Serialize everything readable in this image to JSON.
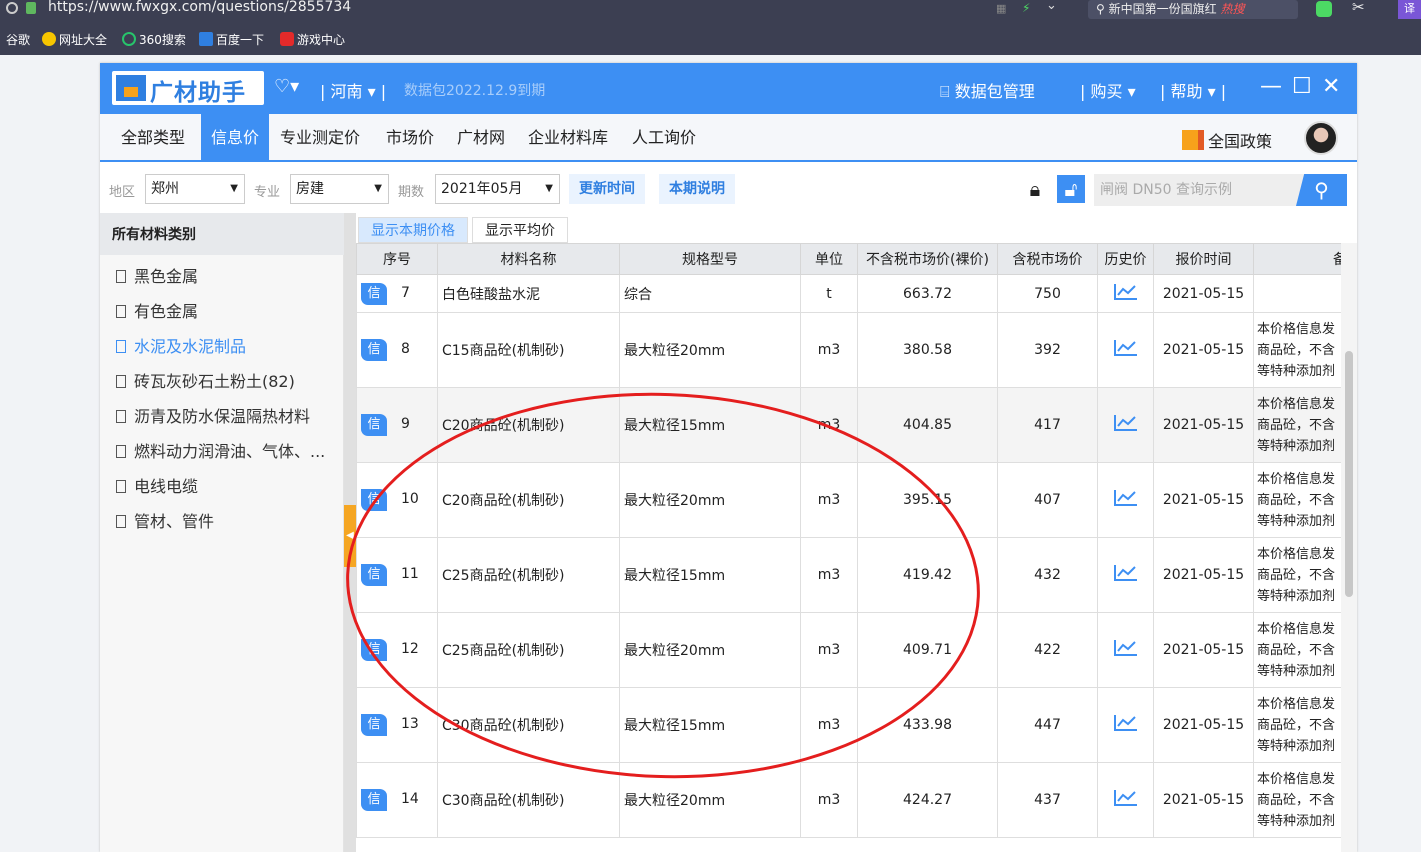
{
  "browser": {
    "url": "https://www.fwxgx.com/questions/2855734",
    "search_text": "新中国第一份国旗红",
    "search_hot": "热搜",
    "translate": "译"
  },
  "bookmarks": [
    "谷歌",
    "网址大全",
    "360搜索",
    "百度一下",
    "游戏中心"
  ],
  "app": {
    "logo": "广材助手",
    "region": "河南",
    "package_info": "数据包2022.12.9到期",
    "package_mgmt": "数据包管理",
    "buy": "购买",
    "help": "帮助",
    "nav_tabs": [
      "全部类型",
      "信息价",
      "专业测定价",
      "市场价",
      "广材网",
      "企业材料库",
      "人工询价"
    ],
    "policy": "全国政策",
    "filters": {
      "area_label": "地区",
      "area_value": "郑州",
      "major_label": "专业",
      "major_value": "房建",
      "period_label": "期数",
      "period_value": "2021年05月",
      "update_btn": "更新时间",
      "period_note_btn": "本期说明",
      "search_placeholder": "闸阀 DN50 查询示例"
    },
    "sidebar": {
      "title": "所有材料类别",
      "categories": [
        "黑色金属",
        "有色金属",
        "水泥及水泥制品",
        "砖瓦灰砂石土粉土(82)",
        "沥青及防水保温隔热材料",
        "燃料动力润滑油、气体、...",
        "电线电缆",
        "管材、管件"
      ]
    },
    "price_tabs": [
      "显示本期价格",
      "显示平均价"
    ],
    "columns": [
      "序号",
      "材料名称",
      "规格型号",
      "单位",
      "不含税市场价(裸价)",
      "含税市场价",
      "历史价",
      "报价时间",
      "备"
    ],
    "badge": "信",
    "note_lines": [
      "本价格信息发",
      "商品砼，不含",
      "等特种添加剂"
    ],
    "rows": [
      {
        "no": "7",
        "name": "白色硅酸盐水泥",
        "spec": "综合",
        "unit": "t",
        "price": "663.72",
        "tax_price": "750",
        "date": "2021-05-15"
      },
      {
        "no": "8",
        "name": "C15商品砼(机制砂)",
        "spec": "最大粒径20mm",
        "unit": "m3",
        "price": "380.58",
        "tax_price": "392",
        "date": "2021-05-15"
      },
      {
        "no": "9",
        "name": "C20商品砼(机制砂)",
        "spec": "最大粒径15mm",
        "unit": "m3",
        "price": "404.85",
        "tax_price": "417",
        "date": "2021-05-15"
      },
      {
        "no": "10",
        "name": "C20商品砼(机制砂)",
        "spec": "最大粒径20mm",
        "unit": "m3",
        "price": "395.15",
        "tax_price": "407",
        "date": "2021-05-15"
      },
      {
        "no": "11",
        "name": "C25商品砼(机制砂)",
        "spec": "最大粒径15mm",
        "unit": "m3",
        "price": "419.42",
        "tax_price": "432",
        "date": "2021-05-15"
      },
      {
        "no": "12",
        "name": "C25商品砼(机制砂)",
        "spec": "最大粒径20mm",
        "unit": "m3",
        "price": "409.71",
        "tax_price": "422",
        "date": "2021-05-15"
      },
      {
        "no": "13",
        "name": "C30商品砼(机制砂)",
        "spec": "最大粒径15mm",
        "unit": "m3",
        "price": "433.98",
        "tax_price": "447",
        "date": "2021-05-15"
      },
      {
        "no": "14",
        "name": "C30商品砼(机制砂)",
        "spec": "最大粒径20mm",
        "unit": "m3",
        "price": "424.27",
        "tax_price": "437",
        "date": "2021-05-15"
      }
    ]
  },
  "colors": {
    "accent": "#3d8ff3",
    "annotation": "#e41e1e",
    "sidebar_toggle": "#f5a623"
  }
}
